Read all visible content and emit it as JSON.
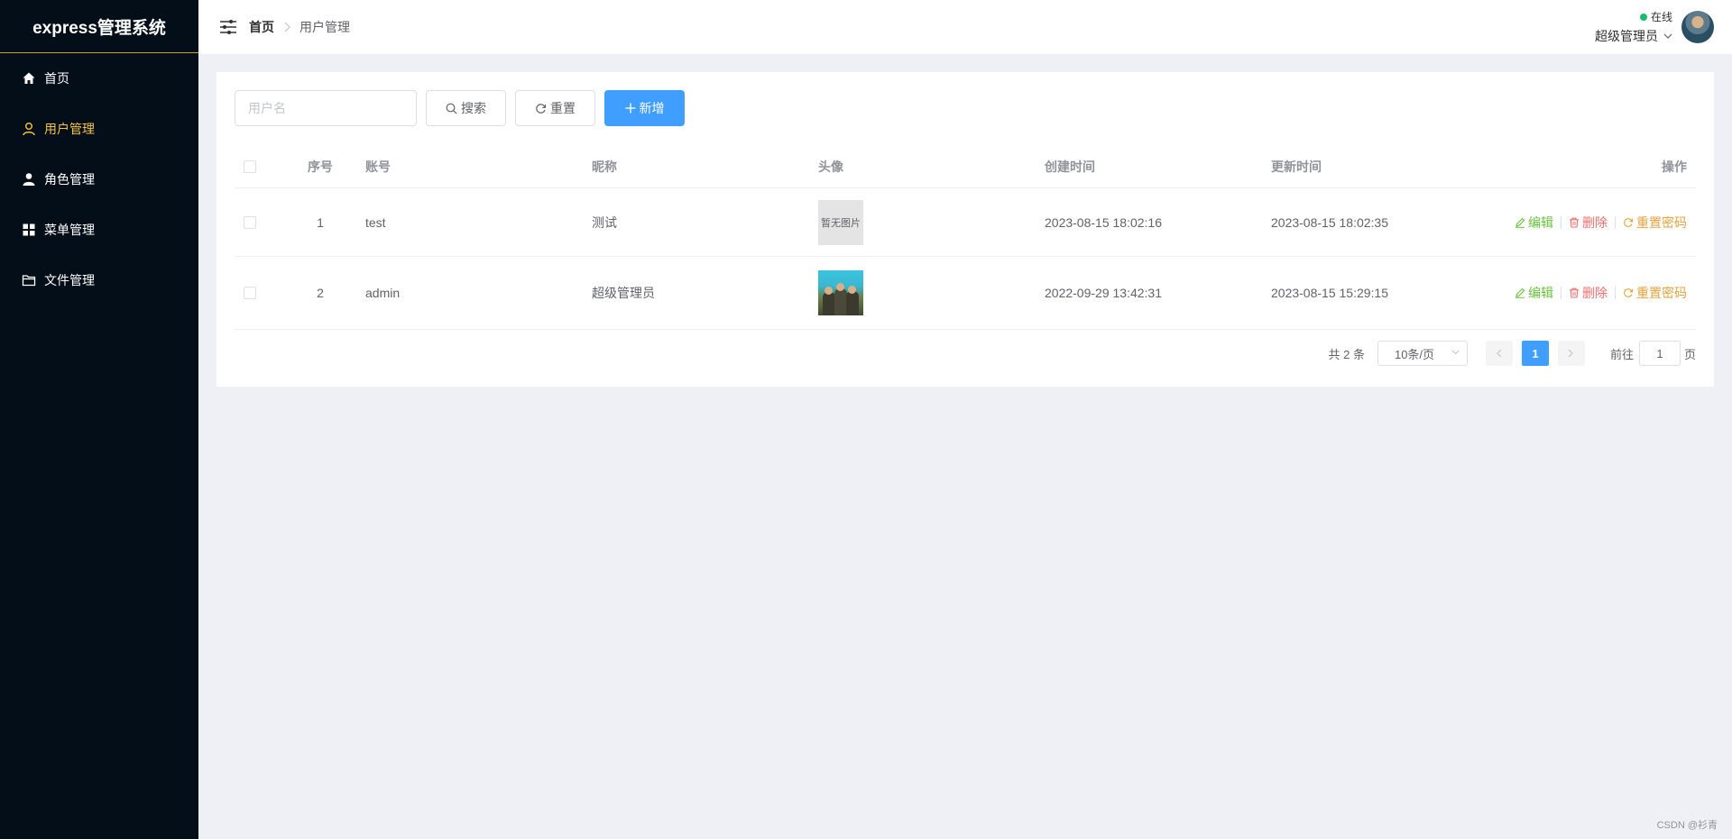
{
  "app": {
    "title": "express管理系统"
  },
  "sidebar": {
    "items": [
      {
        "label": "首页",
        "icon": "home-icon",
        "active": false
      },
      {
        "label": "用户管理",
        "icon": "user-icon",
        "active": true
      },
      {
        "label": "角色管理",
        "icon": "person-icon",
        "active": false
      },
      {
        "label": "菜单管理",
        "icon": "grid-icon",
        "active": false
      },
      {
        "label": "文件管理",
        "icon": "folder-icon",
        "active": false
      }
    ],
    "active_color": "#f6c343"
  },
  "header": {
    "breadcrumb": {
      "home": "首页",
      "current": "用户管理"
    },
    "user": {
      "status": "在线",
      "name": "超级管理员"
    }
  },
  "toolbar": {
    "search_placeholder": "用户名",
    "search_label": "搜索",
    "reset_label": "重置",
    "add_label": "新增"
  },
  "table": {
    "headers": {
      "index": "序号",
      "account": "账号",
      "nickname": "昵称",
      "avatar": "头像",
      "created": "创建时间",
      "updated": "更新时间",
      "actions": "操作"
    },
    "rows": [
      {
        "index": "1",
        "account": "test",
        "nickname": "测试",
        "avatar_text": "暂无图片",
        "created": "2023-08-15 18:02:16",
        "updated": "2023-08-15 18:02:35"
      },
      {
        "index": "2",
        "account": "admin",
        "nickname": "超级管理员",
        "avatar_text": "",
        "created": "2022-09-29 13:42:31",
        "updated": "2023-08-15 15:29:15"
      }
    ],
    "actions": {
      "edit": "编辑",
      "delete": "删除",
      "reset_password": "重置密码"
    }
  },
  "pagination": {
    "total": "共 2 条",
    "page_size": "10条/页",
    "current_page": "1",
    "goto_prefix": "前往",
    "goto_value": "1",
    "goto_suffix": "页"
  },
  "watermark": "CSDN @衫青",
  "colors": {
    "primary": "#409eff",
    "success": "#67c23a",
    "danger": "#f56c6c",
    "warning": "#e6a23c",
    "sidebar_bg": "#030e19"
  }
}
